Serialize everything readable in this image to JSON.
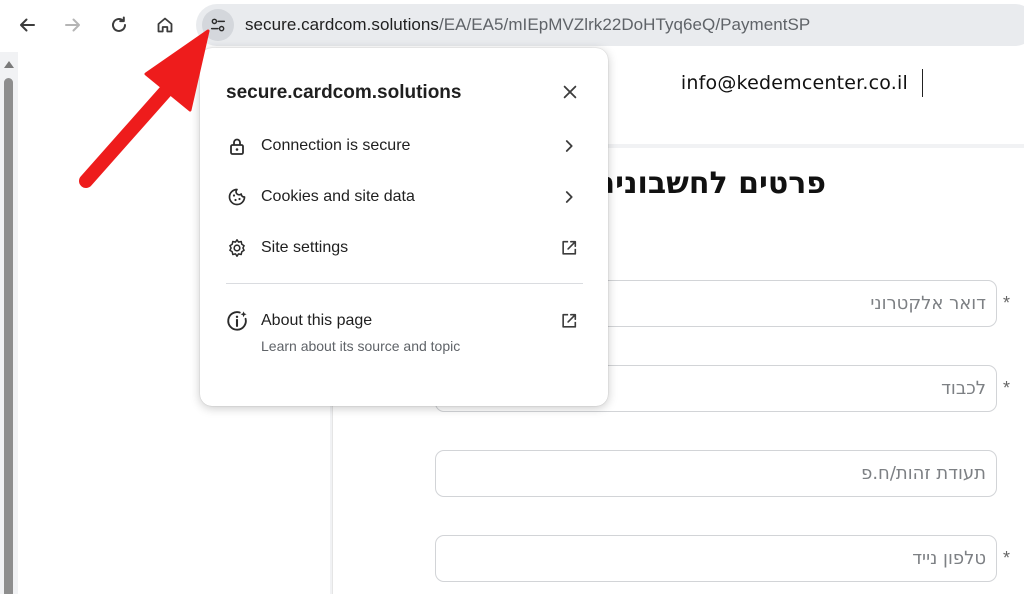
{
  "toolbar": {
    "back_icon": "arrow-left-icon",
    "forward_icon": "arrow-right-icon",
    "reload_icon": "reload-icon",
    "home_icon": "home-icon",
    "site_info_icon": "tune-icon",
    "url_host": "secure.cardcom.solutions",
    "url_path": "/EA/EA5/mIEpMVZlrk22DoHTyq6eQ/PaymentSP"
  },
  "page": {
    "header_email": "info@kedemcenter.co.il",
    "form_title": "פרטים לחשבונית",
    "fields": [
      {
        "placeholder": "דואר אלקטרוני",
        "required": true
      },
      {
        "placeholder": "לכבוד",
        "required": true
      },
      {
        "placeholder": "תעודת זהות/ח.פ",
        "required": false
      },
      {
        "placeholder": "טלפון נייד",
        "required": true
      }
    ],
    "required_mark": "*"
  },
  "popup": {
    "title": "secure.cardcom.solutions",
    "items": [
      {
        "label": "Connection is secure",
        "icon": "lock-icon",
        "trail_icon": "chevron-right-icon"
      },
      {
        "label": "Cookies and site data",
        "icon": "cookie-icon",
        "trail_icon": "chevron-right-icon"
      },
      {
        "label": "Site settings",
        "icon": "gear-icon",
        "trail_icon": "open-in-new-icon"
      }
    ],
    "about": {
      "label": "About this page",
      "sublabel": "Learn about its source and topic",
      "icon": "info-sparkle-icon",
      "trail_icon": "open-in-new-icon"
    }
  },
  "colors": {
    "arrow": "#ee1c1c",
    "omnibox": "#e9ebee"
  }
}
